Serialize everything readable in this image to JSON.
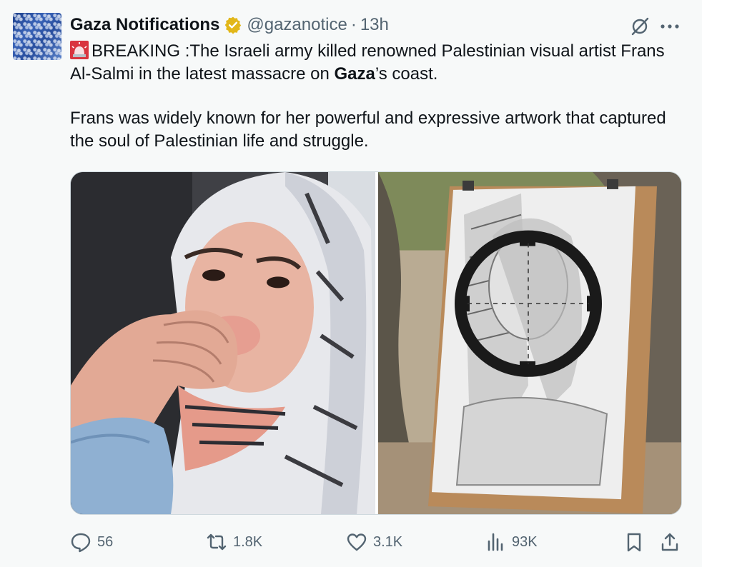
{
  "tweet": {
    "display_name": "Gaza Notifications",
    "handle": "@gazanotice",
    "separator": "·",
    "time": "13h",
    "verified_color": "#e2b719",
    "body_line1": "BREAKING :The Israeli army killed renowned Palestinian visual artist Frans Al-Salmi in the latest massacre on ",
    "body_bold": "Gaza",
    "body_line1_end": "’s coast.",
    "body_para2": "Frans was widely known for her powerful and expressive artwork that captured the soul of Palestinian life and struggle.",
    "icons": {
      "siren": "rotating-light-emoji",
      "grok": "grok-icon",
      "more": "more-icon"
    }
  },
  "media": {
    "left": "portrait-photo",
    "right": "pencil-drawing-on-easel"
  },
  "actions": {
    "replies": "56",
    "reposts": "1.8K",
    "likes": "3.1K",
    "views": "93K"
  },
  "colors": {
    "text": "#0f1419",
    "muted": "#536471",
    "background": "#f7f9f9"
  }
}
